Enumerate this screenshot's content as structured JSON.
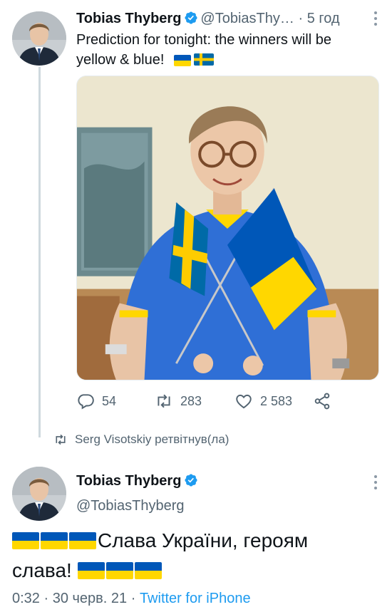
{
  "tweet1": {
    "name": "Tobias Thyberg",
    "handle": "@TobiasThy…",
    "separator": "·",
    "time": "5 год",
    "text_line1": "Prediction for tonight: the winners will be",
    "text_line2": "yellow & blue!",
    "actions": {
      "replies": "54",
      "retweets": "283",
      "likes": "2 583"
    }
  },
  "retweet_note": "Serg Visotskiy ретвітнув(ла)",
  "tweet2": {
    "name": "Tobias Thyberg",
    "handle": "@TobiasThyberg",
    "text_line1": "Слава України, героям",
    "text_line2": "слава!",
    "meta_time": "0:32 · 30 черв. 21 · ",
    "meta_source": "Twitter for iPhone"
  },
  "colors": {
    "accent": "#1d9bf0",
    "flag_blue": "#0057b8",
    "flag_yellow": "#ffd700",
    "secondary_text": "#536471"
  },
  "icons": [
    "verified-badge-icon",
    "more-options-icon",
    "reply-icon",
    "retweet-icon",
    "like-icon",
    "share-icon",
    "sweden-flag-icon",
    "ukraine-flag-icon"
  ]
}
